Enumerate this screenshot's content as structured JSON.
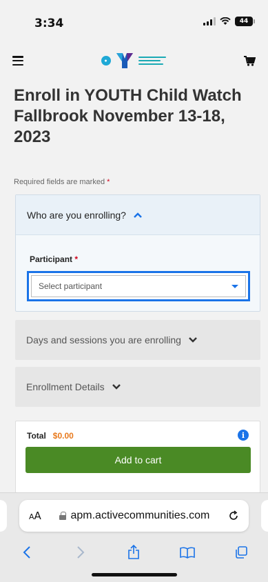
{
  "status": {
    "time": "3:34",
    "battery": "44"
  },
  "colors": {
    "accent": "#1a73e8",
    "button_green": "#4a8a25",
    "total_orange": "#e8791c",
    "required_red": "#d0021b"
  },
  "header": {
    "menu_icon": "hamburger-icon",
    "logo": "ymca-logo",
    "cart_icon": "cart-icon"
  },
  "page": {
    "title": "Enroll in YOUTH Child Watch Fallbrook November 13-18, 2023",
    "required_note": "Required fields are marked",
    "required_star": "*"
  },
  "sections": {
    "who": {
      "title": "Who are you enrolling?",
      "participant_label": "Participant",
      "participant_placeholder": "Select participant"
    },
    "days": {
      "title": "Days and sessions you are enrolling"
    },
    "details": {
      "title": "Enrollment Details"
    }
  },
  "total": {
    "label": "Total",
    "value": "$0.00",
    "button": "Add to cart"
  },
  "browser": {
    "aa_small": "A",
    "aa_big": "A",
    "url": "apm.activecommunities.com"
  }
}
